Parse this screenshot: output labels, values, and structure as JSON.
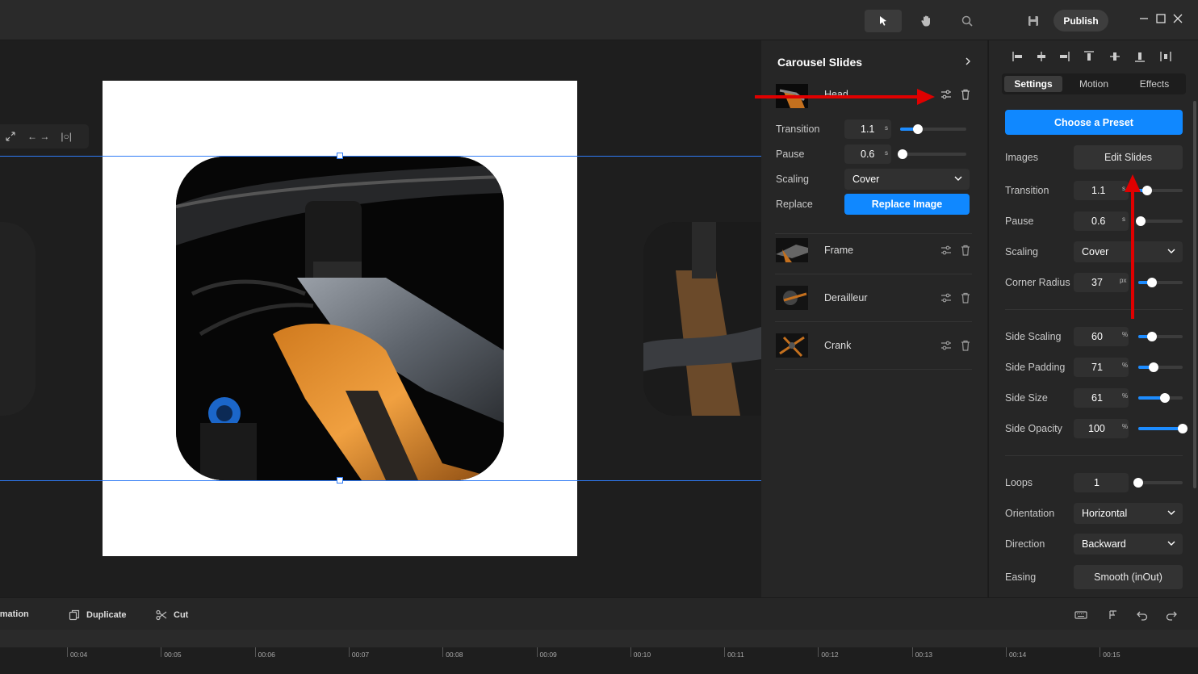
{
  "topbar": {
    "publish_label": "Publish"
  },
  "canvas_tools": {
    "arrows_glyph": "← →",
    "padding_glyph": "|○|"
  },
  "slides_panel": {
    "title": "Carousel Slides",
    "slides": [
      {
        "name": "Head"
      },
      {
        "name": "Frame"
      },
      {
        "name": "Derailleur"
      },
      {
        "name": "Crank"
      }
    ],
    "selected": {
      "transition_label": "Transition",
      "transition_value": "1.1",
      "transition_unit": "s",
      "transition_fraction": 0.27,
      "pause_label": "Pause",
      "pause_value": "0.6",
      "pause_unit": "s",
      "pause_fraction": 0.04,
      "scaling_label": "Scaling",
      "scaling_value": "Cover",
      "replace_label": "Replace",
      "replace_button": "Replace Image"
    }
  },
  "right_panel": {
    "tabs": [
      {
        "label": "Settings",
        "active": true
      },
      {
        "label": "Motion",
        "active": false
      },
      {
        "label": "Effects",
        "active": false
      }
    ],
    "preset_button": "Choose a Preset",
    "images_label": "Images",
    "edit_slides_button": "Edit Slides",
    "transition": {
      "label": "Transition",
      "value": "1.1",
      "unit": "s",
      "fraction": 0.2
    },
    "pause": {
      "label": "Pause",
      "value": "0.6",
      "unit": "s",
      "fraction": 0.05
    },
    "scaling": {
      "label": "Scaling",
      "value": "Cover"
    },
    "corner_radius": {
      "label": "Corner Radius",
      "value": "37",
      "unit": "px",
      "fraction": 0.3
    },
    "side_scaling": {
      "label": "Side Scaling",
      "value": "60",
      "unit": "%",
      "fraction": 0.3
    },
    "side_padding": {
      "label": "Side Padding",
      "value": "71",
      "unit": "%",
      "fraction": 0.35
    },
    "side_size": {
      "label": "Side Size",
      "value": "61",
      "unit": "%",
      "fraction": 0.6
    },
    "side_opacity": {
      "label": "Side Opacity",
      "value": "100",
      "unit": "%",
      "fraction": 1.0
    },
    "loops": {
      "label": "Loops",
      "value": "1",
      "fraction": 0.0
    },
    "orientation": {
      "label": "Orientation",
      "value": "Horizontal"
    },
    "direction": {
      "label": "Direction",
      "value": "Backward"
    },
    "easing": {
      "label": "Easing",
      "value": "Smooth (inOut)"
    }
  },
  "bottombar": {
    "animation_label": "Animation",
    "duplicate_label": "Duplicate",
    "cut_label": "Cut"
  },
  "timeline": {
    "ticks": [
      "00:04",
      "00:05",
      "00:06",
      "00:07",
      "00:08",
      "00:09",
      "00:10",
      "00:11",
      "00:12",
      "00:13",
      "00:14",
      "00:15"
    ]
  },
  "colors": {
    "accent": "#1088ff",
    "annotation_arrow": "#e00000",
    "selection": "#2f7bf5"
  }
}
